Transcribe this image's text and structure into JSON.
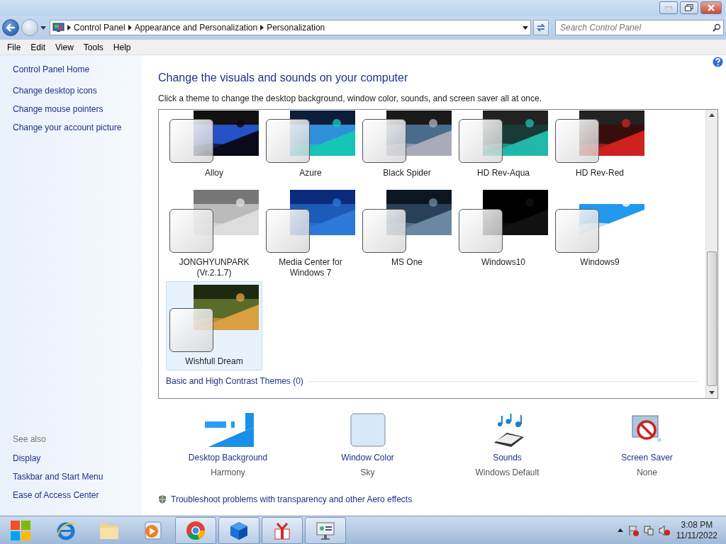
{
  "address_bar": {
    "crumbs": [
      "Control Panel",
      "Appearance and Personalization",
      "Personalization"
    ]
  },
  "search": {
    "placeholder": "Search Control Panel"
  },
  "menu": [
    "File",
    "Edit",
    "View",
    "Tools",
    "Help"
  ],
  "sidebar": {
    "home": "Control Panel Home",
    "links": [
      "Change desktop icons",
      "Change mouse pointers",
      "Change your account picture"
    ],
    "see_also_title": "See also",
    "see_also": [
      "Display",
      "Taskbar and Start Menu",
      "Ease of Access Center"
    ]
  },
  "heading": "Change the visuals and sounds on your computer",
  "description": "Click a theme to change the desktop background, window color, sounds, and screen saver all at once.",
  "themes": [
    {
      "name": "Alloy",
      "selected": false
    },
    {
      "name": "Azure",
      "selected": false
    },
    {
      "name": "Black Spider",
      "selected": false
    },
    {
      "name": "HD Rev-Aqua",
      "selected": false
    },
    {
      "name": "HD Rev-Red",
      "selected": false
    },
    {
      "name": "JONGHYUNPARK (Vr.2.1.7)",
      "selected": false
    },
    {
      "name": "Media Center for Windows 7",
      "selected": false
    },
    {
      "name": "MS One",
      "selected": false
    },
    {
      "name": "Windows10",
      "selected": false
    },
    {
      "name": "Windows9",
      "selected": false
    },
    {
      "name": "Wishfull Dream",
      "selected": true
    }
  ],
  "section": "Basic and High Contrast Themes (0)",
  "settings": [
    {
      "kind": "background",
      "title": "Desktop Background",
      "value": "Harmony"
    },
    {
      "kind": "color",
      "title": "Window Color",
      "value": "Sky"
    },
    {
      "kind": "sounds",
      "title": "Sounds",
      "value": "Windows Default"
    },
    {
      "kind": "saver",
      "title": "Screen Saver",
      "value": "None"
    }
  ],
  "troubleshoot": "Troubleshoot problems with transparency and other Aero effects",
  "taskbar": {
    "apps": [
      {
        "kind": "ie",
        "running": false
      },
      {
        "kind": "folder",
        "running": false
      },
      {
        "kind": "media",
        "running": false
      },
      {
        "kind": "chrome",
        "running": true
      },
      {
        "kind": "cube",
        "running": true
      },
      {
        "kind": "gift",
        "running": true
      },
      {
        "kind": "panel",
        "running": true
      }
    ],
    "time": "3:08 PM",
    "date": "11/11/2022"
  }
}
